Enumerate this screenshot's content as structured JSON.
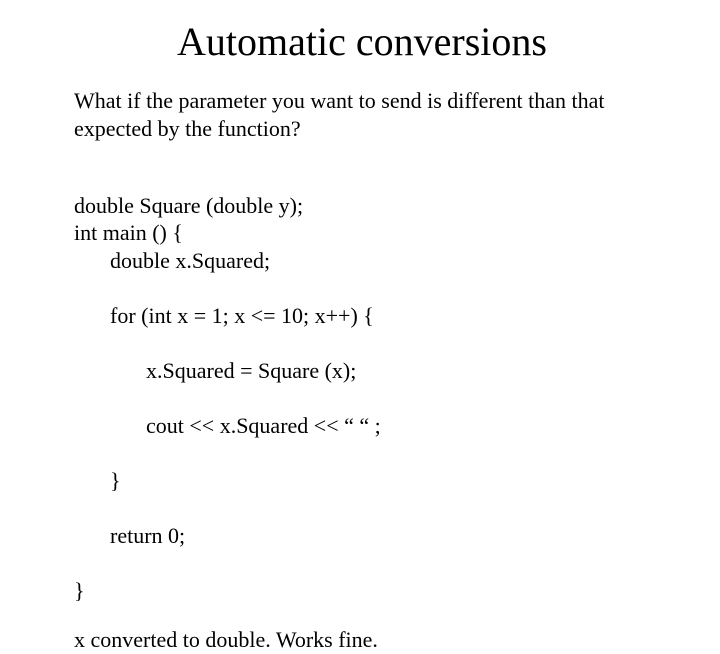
{
  "title": "Automatic conversions",
  "intro": "What if the parameter you want to send is different than that expected by the function?",
  "code": {
    "l1": "double Square (double y);",
    "l2": "int main () {",
    "l3": "double x.Squared;",
    "l4": "for (int x = 1; x <= 10; x++) {",
    "l5": "x.Squared = Square (x);",
    "l6": "cout << x.Squared << “ “ ;",
    "l7": "}",
    "l8": "return 0;",
    "l9": "}"
  },
  "conclusion": "x converted to double. Works fine."
}
